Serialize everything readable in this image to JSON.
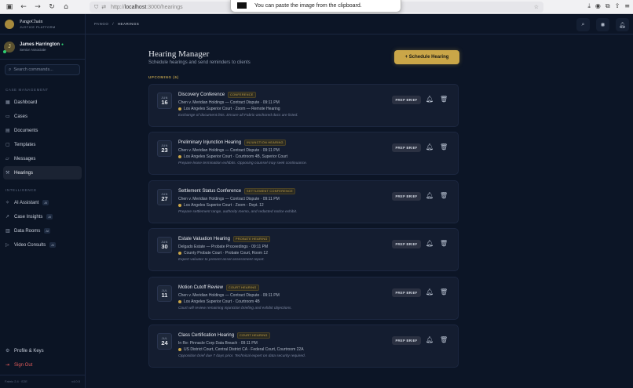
{
  "browser": {
    "url_prefix": "http://",
    "url_host": "localhost",
    "url_path": ":3000/hearings",
    "toast": "You can paste the image from the clipboard."
  },
  "sidebar": {
    "brand_name": "PangoChain",
    "brand_sub": "JUSTICE PLATFORM",
    "user_name": "James Harrington",
    "user_role": "Senior Associate",
    "user_initial": "J",
    "search_placeholder": "Search commands...",
    "section_case": "CASE MANAGEMENT",
    "section_intel": "INTELLIGENCE",
    "items": [
      {
        "label": "Dashboard",
        "icon": "grid-icon"
      },
      {
        "label": "Cases",
        "icon": "folder-icon"
      },
      {
        "label": "Documents",
        "icon": "document-icon"
      },
      {
        "label": "Templates",
        "icon": "template-icon"
      },
      {
        "label": "Messages",
        "icon": "message-icon"
      },
      {
        "label": "Hearings",
        "icon": "gavel-icon"
      }
    ],
    "intel_items": [
      {
        "label": "AI Assistant",
        "badge": "AI"
      },
      {
        "label": "Case Insights",
        "badge": "AI"
      },
      {
        "label": "Data Rooms",
        "badge": "AI"
      },
      {
        "label": "Video Consults",
        "badge": "AI"
      }
    ],
    "profile": "Profile & Keys",
    "signout": "Sign Out",
    "footer_left": "Fabric 2.4 · E2E",
    "footer_right": "v4.0.0"
  },
  "topbar": {
    "crumb_root": "PANGO",
    "crumb_sep": "/",
    "crumb_current": "HEARINGS"
  },
  "main": {
    "title": "Hearing Manager",
    "subtitle": "Schedule hearings and send reminders to clients",
    "schedule_button": "+ Schedule Hearing",
    "upcoming_label": "UPCOMING (6)",
    "prep_label": "PREP BRIEF"
  },
  "hearings": [
    {
      "month": "JUN",
      "day": "16",
      "title": "Discovery Conference",
      "tag": "CONFERENCE",
      "case": "Chen v. Meridian Holdings — Contract Dispute · 09:11 PM",
      "location": "Los Angeles Superior Court · Zoom — Remote Hearing",
      "note": "Exchange of document lists. Ensure all Fabric-anchored docs are listed."
    },
    {
      "month": "JUN",
      "day": "23",
      "title": "Preliminary Injunction Hearing",
      "tag": "INJUNCTION HEARING",
      "case": "Chen v. Meridian Holdings — Contract Dispute · 09:11 PM",
      "location": "Los Angeles Superior Court · Courtroom 4B, Superior Court",
      "note": "Prepare lease termination exhibits. Opposing counsel may seek continuance."
    },
    {
      "month": "JUN",
      "day": "27",
      "title": "Settlement Status Conference",
      "tag": "SETTLEMENT CONFERENCE",
      "case": "Chen v. Meridian Holdings — Contract Dispute · 09:11 PM",
      "location": "Los Angeles Superior Court · Zoom - Dept. 12",
      "note": "Prepare settlement range, authority memo, and redacted notice exhibit."
    },
    {
      "month": "JUN",
      "day": "30",
      "title": "Estate Valuation Hearing",
      "tag": "PROBATE HEARING",
      "case": "Delgado Estate — Probate Proceedings · 09:11 PM",
      "location": "County Probate Court · Probate Court, Room 12",
      "note": "Expert valuator to present asset assessment report."
    },
    {
      "month": "JUL",
      "day": "11",
      "title": "Motion Cutoff Review",
      "tag": "COURT HEARING",
      "case": "Chen v. Meridian Holdings — Contract Dispute · 09:11 PM",
      "location": "Los Angeles Superior Court · Courtroom 4B",
      "note": "Court will review remaining injunction briefing and exhibit objections."
    },
    {
      "month": "JUL",
      "day": "24",
      "title": "Class Certification Hearing",
      "tag": "COURT HEARING",
      "case": "In Re: Pinnacle Corp Data Breach · 09:11 PM",
      "location": "US District Court, Central District CA · Federal Court, Courtroom 22A",
      "note": "Opposition brief due 7 days prior. Technical expert on data security required."
    }
  ]
}
